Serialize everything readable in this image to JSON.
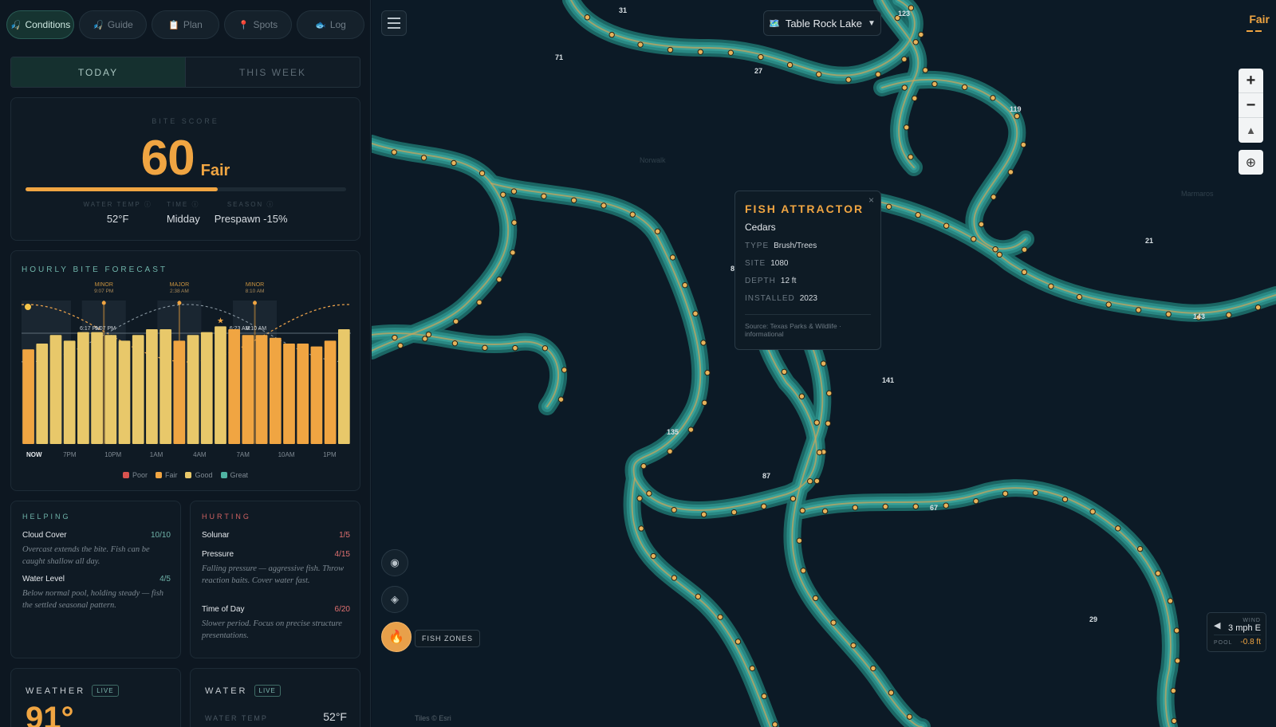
{
  "nav": {
    "items": [
      {
        "icon": "🎣",
        "label": "Conditions",
        "active": true
      },
      {
        "icon": "🎣",
        "label": "Guide",
        "active": false
      },
      {
        "icon": "📋",
        "label": "Plan",
        "active": false
      },
      {
        "icon": "📍",
        "label": "Spots",
        "active": false
      },
      {
        "icon": "🐟",
        "label": "Log",
        "active": false
      }
    ]
  },
  "tabs": {
    "today": "TODAY",
    "week": "THIS WEEK"
  },
  "bite": {
    "title": "BITE SCORE",
    "score": "60",
    "label": "Fair",
    "score_fraction": 0.6,
    "factors": [
      {
        "label": "WATER TEMP ⓘ",
        "value": "52°F"
      },
      {
        "label": "TIME ⓘ",
        "value": "Midday"
      },
      {
        "label": "SEASON ⓘ",
        "value": "Prespawn -15%"
      }
    ]
  },
  "hourly": {
    "title": "HOURLY BITE FORECAST",
    "legend": [
      {
        "label": "Poor",
        "color": "#d9534f"
      },
      {
        "label": "Fair",
        "color": "#f0a542"
      },
      {
        "label": "Good",
        "color": "#e8c86a"
      },
      {
        "label": "Great",
        "color": "#4fb3a3"
      }
    ]
  },
  "chart_data": {
    "type": "bar",
    "title": "HOURLY BITE FORECAST",
    "categories": [
      "NOW",
      "",
      "",
      "7PM",
      "",
      "",
      "10PM",
      "",
      "",
      "1AM",
      "",
      "",
      "4AM",
      "",
      "",
      "7AM",
      "",
      "",
      "10AM",
      "",
      "",
      "1PM",
      "",
      ""
    ],
    "values": [
      66,
      70,
      76,
      72,
      78,
      78,
      76,
      72,
      76,
      80,
      80,
      72,
      76,
      78,
      82,
      80,
      76,
      76,
      74,
      70,
      70,
      68,
      72,
      80
    ],
    "bar_colors": [
      "#f0a542",
      "#e8c86a",
      "#e8c86a",
      "#e8c86a",
      "#e8c86a",
      "#e8c86a",
      "#e8c86a",
      "#e8c86a",
      "#e8c86a",
      "#e8c86a",
      "#e8c86a",
      "#f0a542",
      "#e8c86a",
      "#e8c86a",
      "#e8c86a",
      "#f0a542",
      "#f0a542",
      "#f0a542",
      "#f0a542",
      "#f0a542",
      "#f0a542",
      "#f0a542",
      "#f0a542",
      "#e8c86a"
    ],
    "ylim": [
      0,
      100
    ],
    "best_index": 14,
    "markers": [
      {
        "label": "MINOR",
        "time": "9:07 PM",
        "index": 5.5
      },
      {
        "label": "MAJOR",
        "time": "2:38 AM",
        "index": 11
      },
      {
        "label": "MINOR",
        "time": "8:10 AM",
        "index": 16.5
      }
    ],
    "curve_labels": [
      {
        "text": "6:17 PM",
        "index": 4.5
      },
      {
        "text": "9:07 PM",
        "index": 5.6
      },
      {
        "text": "6:23 AM",
        "index": 15.4
      },
      {
        "text": "8:10 AM",
        "index": 16.6
      }
    ],
    "xticks": [
      "NOW",
      "7PM",
      "10PM",
      "1AM",
      "4AM",
      "7AM",
      "10AM",
      "1PM"
    ],
    "legend": [
      "Poor",
      "Fair",
      "Good",
      "Great"
    ]
  },
  "helping": {
    "title": "HELPING",
    "items": [
      {
        "name": "Cloud Cover",
        "score": "10/10",
        "desc": "Overcast extends the bite. Fish can be caught shallow all day."
      },
      {
        "name": "Water Level",
        "score": "4/5",
        "desc": "Below normal pool, holding steady — fish the settled seasonal pattern."
      }
    ]
  },
  "hurting": {
    "title": "HURTING",
    "items": [
      {
        "name": "Solunar",
        "score": "1/5",
        "desc": ""
      },
      {
        "name": "Pressure",
        "score": "4/15",
        "desc": "Falling pressure — aggressive fish. Throw reaction baits. Cover water fast."
      },
      {
        "name": "Time of Day",
        "score": "6/20",
        "desc": "Slower period. Focus on precise structure presentations."
      }
    ]
  },
  "weather": {
    "title": "WEATHER",
    "live": "LIVE",
    "temp": "91°"
  },
  "water": {
    "title": "WATER",
    "live": "LIVE",
    "temp_label": "WATER TEMP",
    "temp": "52°F"
  },
  "map": {
    "lake": "Table Rock Lake",
    "lake_icon": "🗺️",
    "fair_badge": "Fair",
    "popup": {
      "title": "FISH ATTRACTOR",
      "name": "Cedars",
      "rows": [
        {
          "k": "TYPE",
          "v": "Brush/Trees"
        },
        {
          "k": "SITE",
          "v": "1080"
        },
        {
          "k": "DEPTH",
          "v": "12 ft"
        },
        {
          "k": "INSTALLED",
          "v": "2023"
        }
      ],
      "source": "Source: Texas Parks & Wildlife · informational"
    },
    "fish_zones": "FISH ZONES",
    "wind": {
      "label": "WIND",
      "value": "3 mph E"
    },
    "pool": {
      "label": "POOL",
      "value": "-0.8 ft"
    },
    "tiles": "Tiles © Esri",
    "towns": [
      "Norwalk",
      "Marmaros"
    ]
  },
  "colors": {
    "accent": "#f0a542",
    "teal": "#4fb3a3",
    "bad": "#e07070"
  }
}
